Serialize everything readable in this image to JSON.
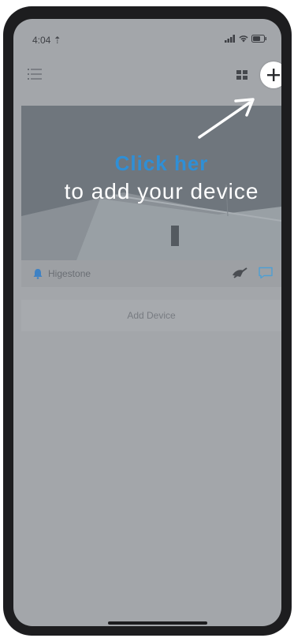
{
  "status_bar": {
    "time": "4:04 ⇡"
  },
  "toolbar": {
    "menu_icon": "list-menu-icon",
    "grid_icon": "grid-view-icon",
    "add_icon": "plus-icon"
  },
  "overlay_hint": {
    "click_text": "Click her",
    "instruction_text": "to add your device"
  },
  "device": {
    "name": "Higestone",
    "bell_icon": "bell-icon",
    "mute_icon": "mute-icon",
    "message_icon": "chat-icon"
  },
  "add_device": {
    "label": "Add Device"
  },
  "colors": {
    "overlay": "#a3a6aa",
    "accent_blue": "#2f8fd6",
    "hint_white": "#ffffff"
  }
}
